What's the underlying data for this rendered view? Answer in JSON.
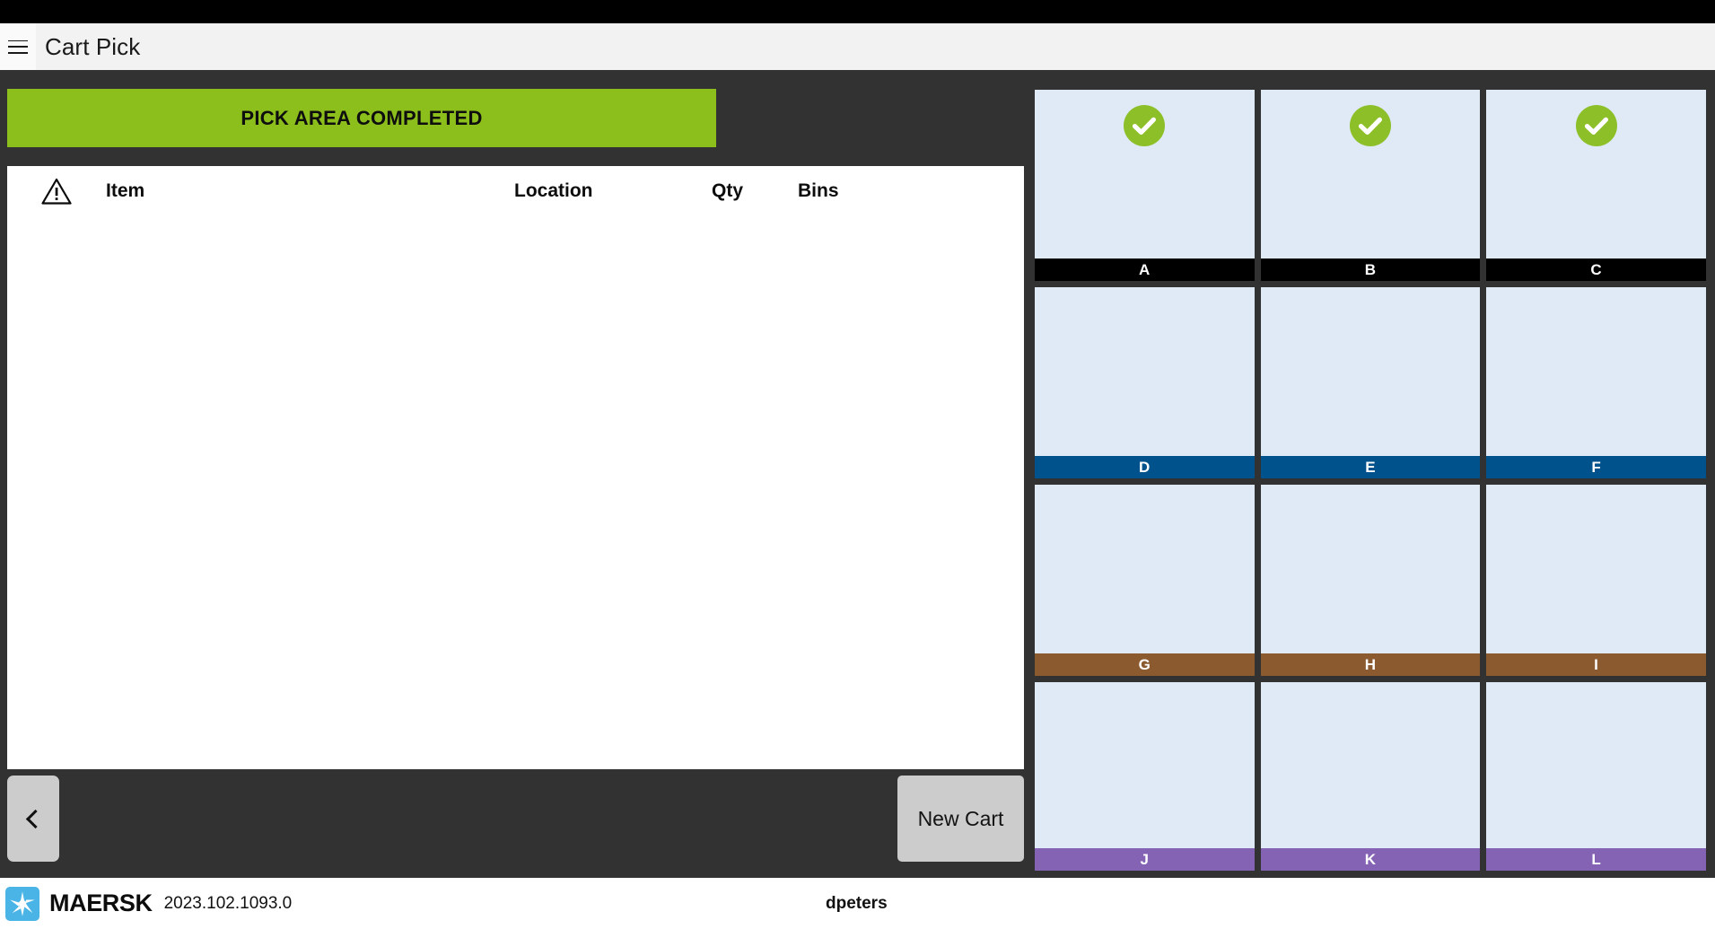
{
  "window": {
    "title": "Cart Pick"
  },
  "titlebar": {
    "menu_icon": "hamburger-menu-icon",
    "title": "Cart Pick"
  },
  "status_banner": {
    "label": "PICK AREA COMPLETED",
    "color": "#8dbf1c",
    "text_color": "#0e0e0e"
  },
  "pick_list": {
    "warning_icon": "warning-triangle-icon",
    "columns": [
      {
        "key": "warning",
        "label": ""
      },
      {
        "key": "item",
        "label": "Item"
      },
      {
        "key": "location",
        "label": "Location"
      },
      {
        "key": "qty",
        "label": "Qty"
      },
      {
        "key": "bins",
        "label": "Bins"
      }
    ],
    "rows": []
  },
  "actions": {
    "back_label": "",
    "back_icon": "chevron-left-icon",
    "new_cart_label": "New Cart"
  },
  "bin_grid": {
    "body_color": "#dfeaf6",
    "rows": [
      {
        "tone": "tone-black",
        "tone_color": "#000000",
        "bins": [
          {
            "label": "A",
            "status": "complete",
            "icon": "check-circle-icon"
          },
          {
            "label": "B",
            "status": "complete",
            "icon": "check-circle-icon"
          },
          {
            "label": "C",
            "status": "complete",
            "icon": "check-circle-icon"
          }
        ]
      },
      {
        "tone": "tone-blue",
        "tone_color": "#00528c",
        "bins": [
          {
            "label": "D",
            "status": "empty",
            "icon": ""
          },
          {
            "label": "E",
            "status": "empty",
            "icon": ""
          },
          {
            "label": "F",
            "status": "empty",
            "icon": ""
          }
        ]
      },
      {
        "tone": "tone-brown",
        "tone_color": "#8b5a2f",
        "bins": [
          {
            "label": "G",
            "status": "empty",
            "icon": ""
          },
          {
            "label": "H",
            "status": "empty",
            "icon": ""
          },
          {
            "label": "I",
            "status": "empty",
            "icon": ""
          }
        ]
      },
      {
        "tone": "tone-purple",
        "tone_color": "#8563b4",
        "bins": [
          {
            "label": "J",
            "status": "empty",
            "icon": ""
          },
          {
            "label": "K",
            "status": "empty",
            "icon": ""
          },
          {
            "label": "L",
            "status": "empty",
            "icon": ""
          }
        ]
      }
    ]
  },
  "footer": {
    "brand_name": "MAERSK",
    "brand_icon": "maersk-star-logo",
    "brand_color": "#4ab4e6",
    "version": "2023.102.1093.0",
    "user": "dpeters"
  }
}
